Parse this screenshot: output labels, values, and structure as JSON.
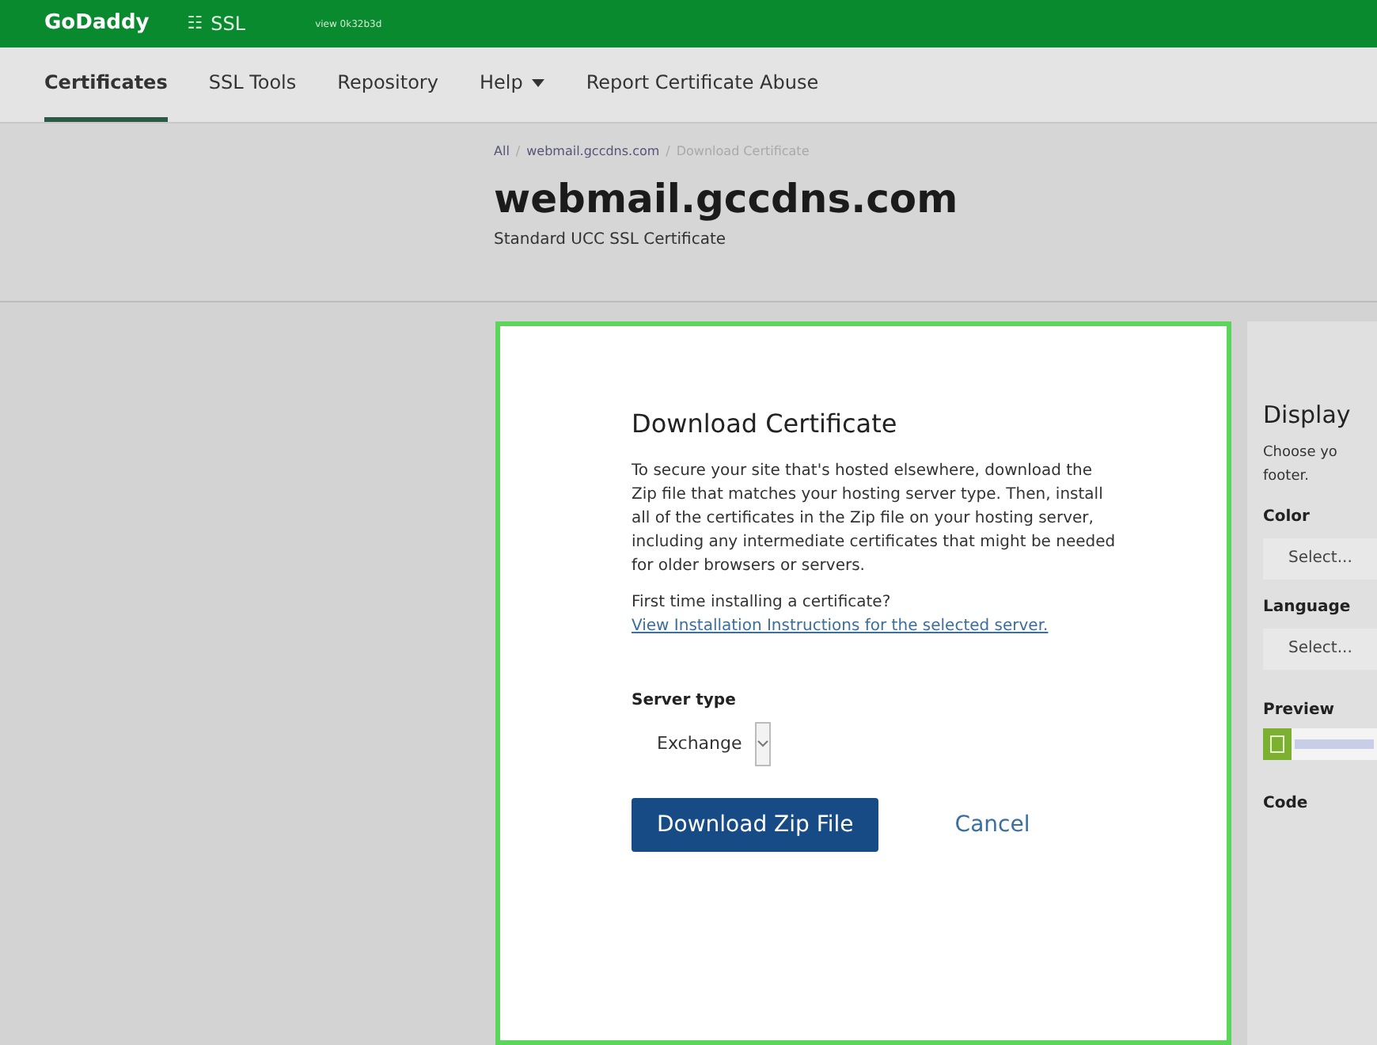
{
  "topbar": {
    "logo": "GoDaddy",
    "product_icon": "☷",
    "product": "SSL",
    "account": "view 0k32b3d"
  },
  "nav": [
    {
      "label": "Certificates",
      "selected": true,
      "dropdown": false
    },
    {
      "label": "SSL Tools",
      "selected": false,
      "dropdown": false
    },
    {
      "label": "Repository",
      "selected": false,
      "dropdown": false
    },
    {
      "label": "Help",
      "selected": false,
      "dropdown": true
    },
    {
      "label": "Report Certificate Abuse",
      "selected": false,
      "dropdown": false
    }
  ],
  "breadcrumb_separator": "/",
  "breadcrumb": [
    {
      "label": "All",
      "current": false
    },
    {
      "label": "webmail.gccdns.com",
      "current": false
    },
    {
      "label": "Download Certificate",
      "current": true
    }
  ],
  "title": "webmail.gccdns.com",
  "subtitle": "Standard UCC SSL Certificate",
  "card": {
    "heading": "Download Certificate",
    "body": "To secure your site that's hosted elsewhere, download the Zip file that matches your hosting server type. Then, install all of the certificates in the Zip file on your hosting server, including any intermediate certificates that might be needed for older browsers or servers.",
    "help_text": "First time installing a certificate?",
    "help_link": "View Installation Instructions for the selected server.",
    "field_label": "Server type",
    "field_value": "Exchange",
    "primary_button": "Download Zip File",
    "secondary_button": "Cancel"
  },
  "side": {
    "heading": "Display",
    "text_lines": [
      "Choose yo",
      "footer."
    ],
    "fields": [
      {
        "label": "Color",
        "value": "Select..."
      },
      {
        "label": "Language",
        "value": "Select..."
      }
    ],
    "preview_label": "Preview",
    "code_label": "Code"
  }
}
